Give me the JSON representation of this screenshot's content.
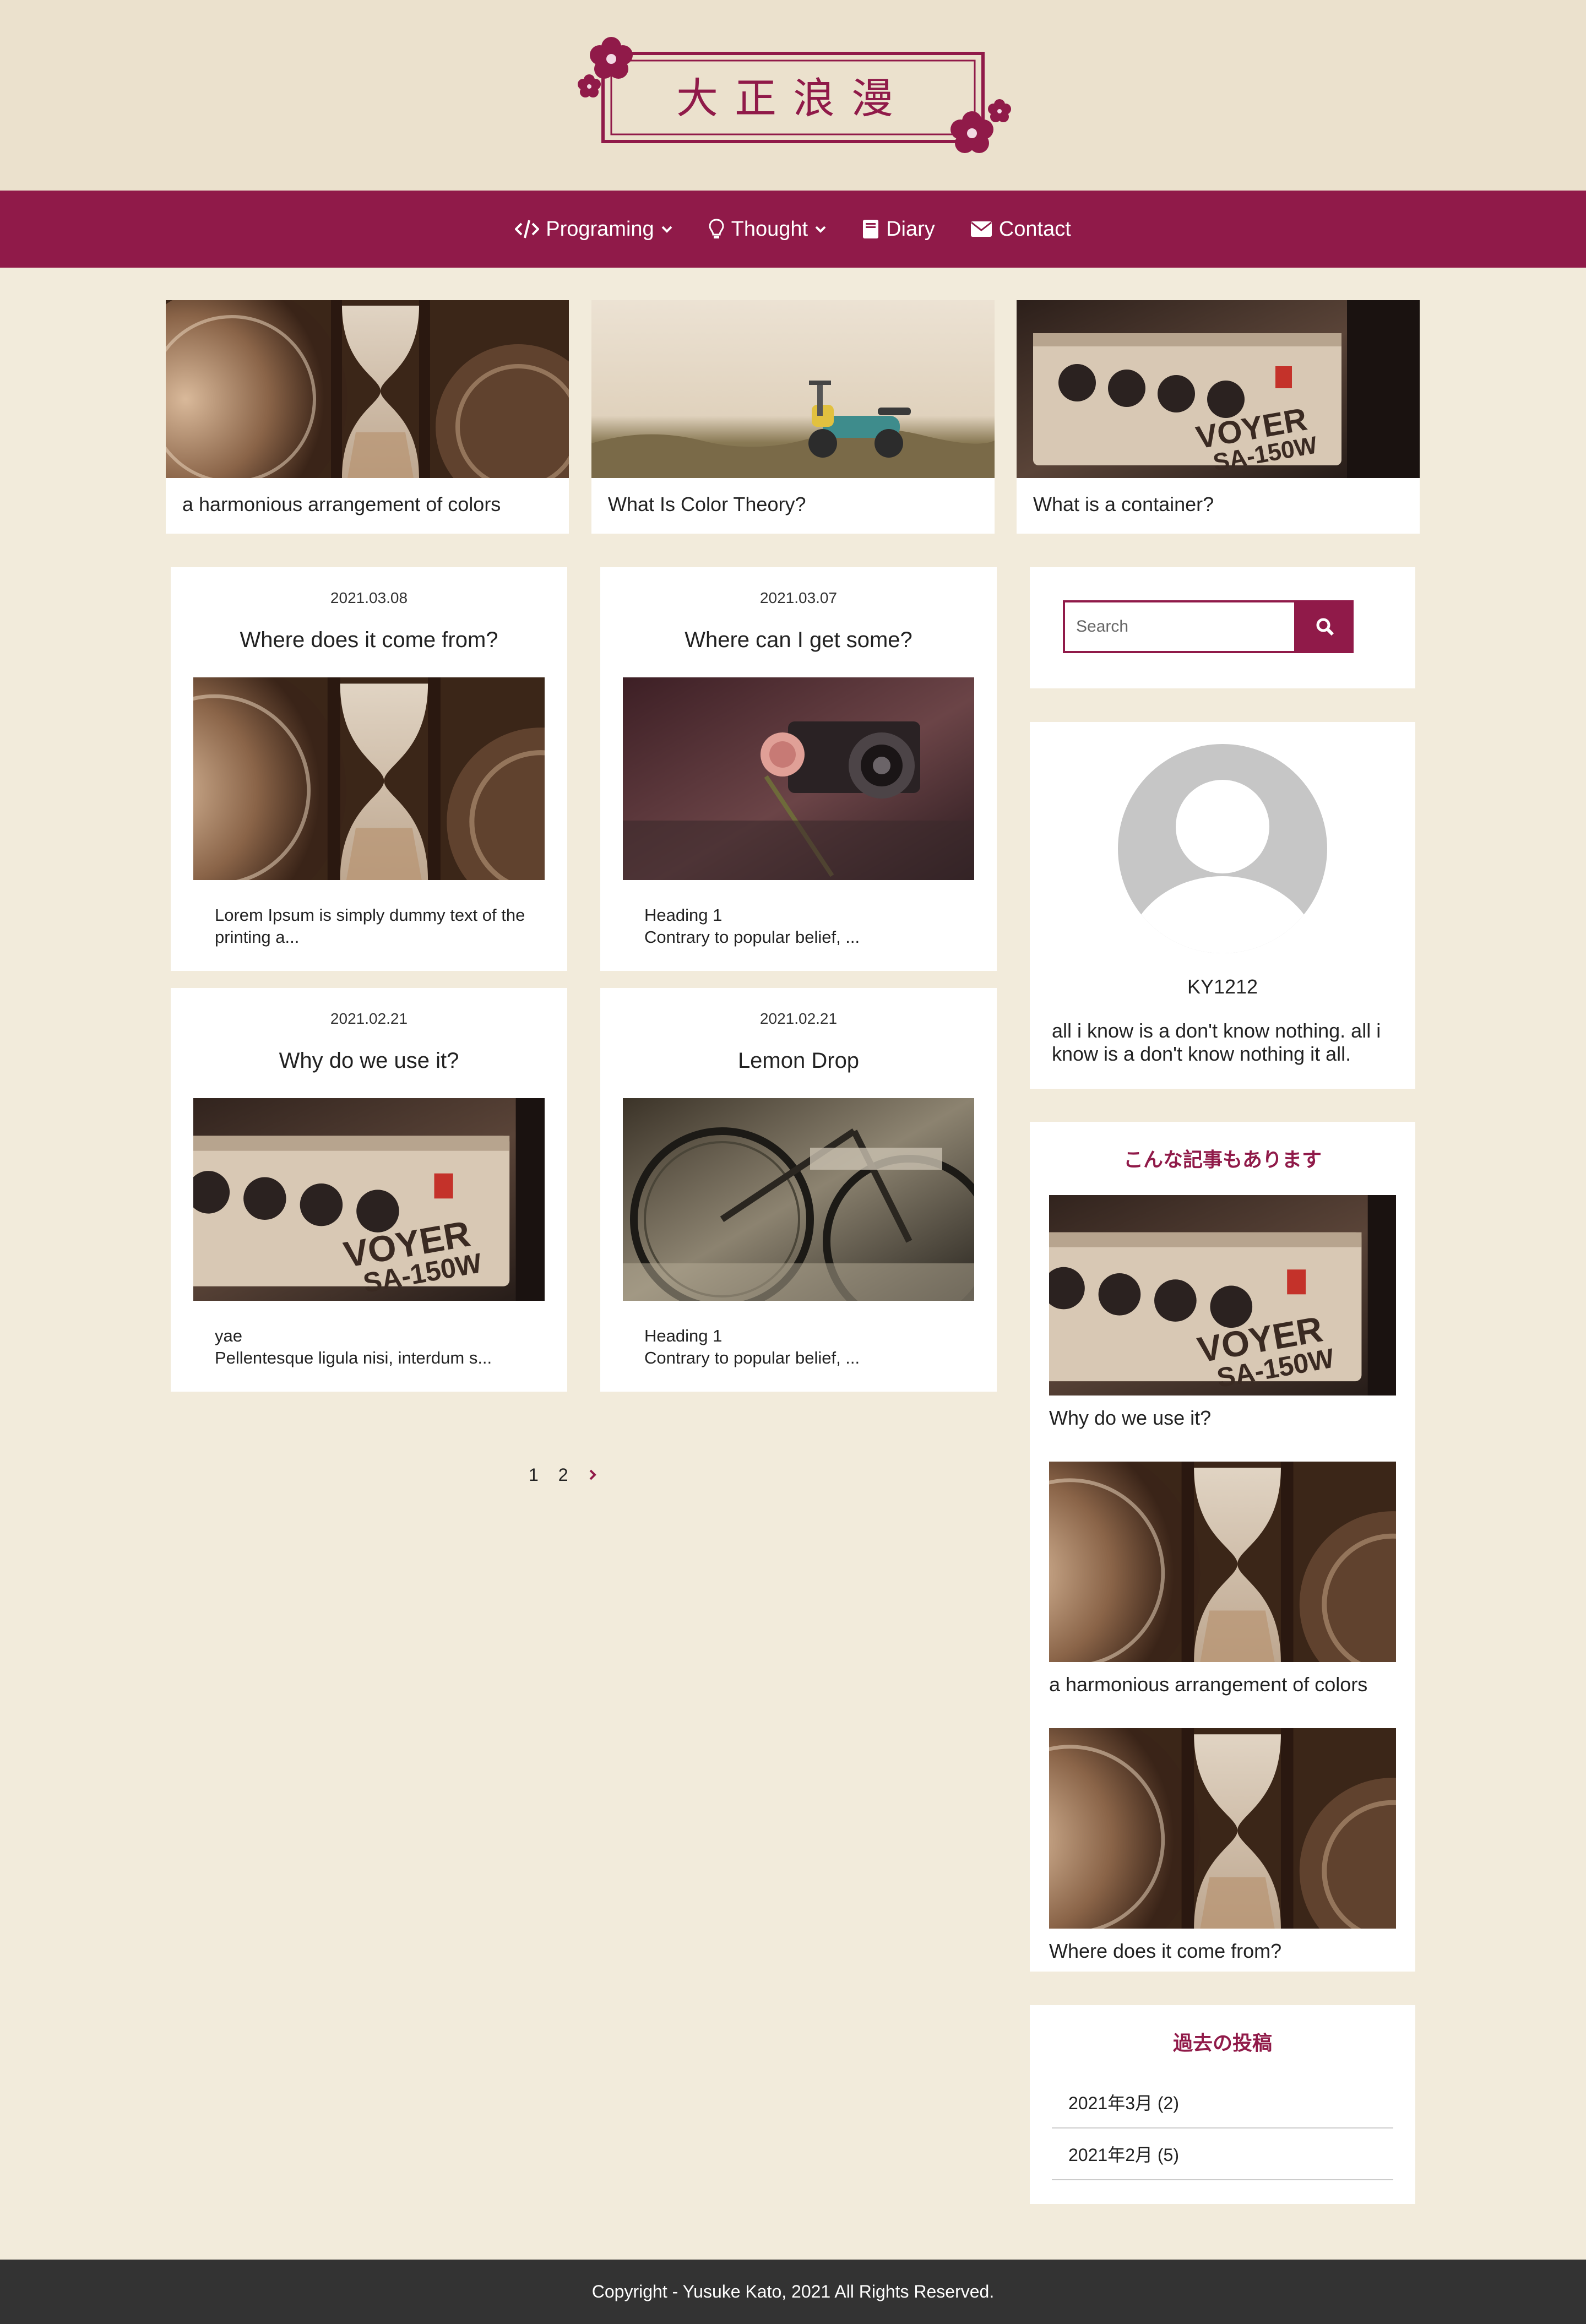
{
  "site": {
    "logo_text": "大正浪漫"
  },
  "nav": {
    "items": [
      {
        "label": "Programing",
        "icon": "code-icon",
        "has_dropdown": true
      },
      {
        "label": "Thought",
        "icon": "lightbulb-icon",
        "has_dropdown": true
      },
      {
        "label": "Diary",
        "icon": "book-icon",
        "has_dropdown": false
      },
      {
        "label": "Contact",
        "icon": "envelope-icon",
        "has_dropdown": false
      }
    ]
  },
  "featured": [
    {
      "title": "a harmonious arrangement of colors",
      "image": "hourglass-photo"
    },
    {
      "title": "What Is Color Theory?",
      "image": "scooter-photo"
    },
    {
      "title": "What is a container?",
      "image": "amplifier-photo"
    }
  ],
  "posts": [
    {
      "date": "2021.03.08",
      "title": "Where does it come from?",
      "image": "hourglass-photo",
      "excerpt": "Lorem Ipsum is simply dummy text of the printing a..."
    },
    {
      "date": "2021.03.07",
      "title": "Where can I get some?",
      "image": "camera-rose-photo",
      "excerpt": "Heading 1\nContrary to popular belief, ..."
    },
    {
      "date": "2021.02.21",
      "title": "Why do we use it?",
      "image": "amplifier-photo",
      "excerpt": "yae\nPellentesque ligula nisi, interdum s..."
    },
    {
      "date": "2021.02.21",
      "title": "Lemon Drop",
      "image": "bicycle-photo",
      "excerpt": "Heading 1\nContrary to popular belief, ..."
    }
  ],
  "pagination": {
    "pages": [
      "1",
      "2"
    ],
    "next": "›"
  },
  "search": {
    "placeholder": "Search"
  },
  "profile": {
    "name": "KY1212",
    "bio": "all i know is a don't know nothing. all i know is a don't know nothing it all."
  },
  "related": {
    "heading": "こんな記事もあります",
    "items": [
      {
        "title": "Why do we use it?",
        "image": "amplifier-photo"
      },
      {
        "title": "a harmonious arrangement of colors",
        "image": "hourglass-photo"
      },
      {
        "title": "Where does it come from?",
        "image": "hourglass-photo"
      }
    ]
  },
  "archive": {
    "heading": "過去の投稿",
    "items": [
      {
        "label": "2021年3月 (2)"
      },
      {
        "label": "2021年2月 (5)"
      }
    ]
  },
  "footer": {
    "copyright": "Copyright - Yusuke Kato, 2021 All Rights Reserved."
  },
  "colors": {
    "accent": "#901a49",
    "background": "#f2ebdb",
    "header_bg": "#ebe1cd",
    "footer_bg": "#333333"
  }
}
